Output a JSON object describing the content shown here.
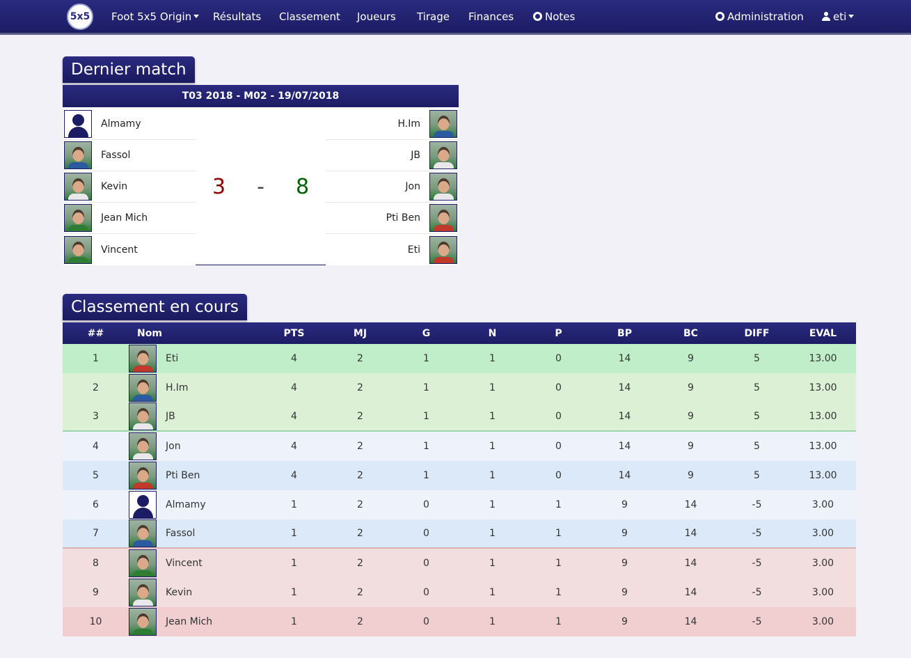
{
  "nav": {
    "logo_text": "5x5",
    "brand": "Foot 5x5 Origin",
    "items": [
      "Résultats",
      "Classement",
      "Joueurs",
      "Tirage",
      "Finances"
    ],
    "notes": "Notes",
    "admin": "Administration",
    "user": "eti"
  },
  "last_match": {
    "title": "Dernier match",
    "header": "T03 2018 - M02 - 19/07/2018",
    "team_left": [
      "Almamy",
      "Fassol",
      "Kevin",
      "Jean Mich",
      "Vincent"
    ],
    "team_right": [
      "H.Im",
      "JB",
      "Jon",
      "Pti Ben",
      "Eti"
    ],
    "score_left": "3",
    "score_sep": "-",
    "score_right": "8"
  },
  "ranking": {
    "title": "Classement en cours",
    "columns": [
      "##",
      "Nom",
      "PTS",
      "MJ",
      "G",
      "N",
      "P",
      "BP",
      "BC",
      "DIFF",
      "EVAL"
    ],
    "rows": [
      {
        "rank": "1",
        "name": "Eti",
        "pts": "4",
        "mj": "2",
        "g": "1",
        "n": "1",
        "p": "0",
        "bp": "14",
        "bc": "9",
        "diff": "5",
        "eval": "13.00"
      },
      {
        "rank": "2",
        "name": "H.Im",
        "pts": "4",
        "mj": "2",
        "g": "1",
        "n": "1",
        "p": "0",
        "bp": "14",
        "bc": "9",
        "diff": "5",
        "eval": "13.00"
      },
      {
        "rank": "3",
        "name": "JB",
        "pts": "4",
        "mj": "2",
        "g": "1",
        "n": "1",
        "p": "0",
        "bp": "14",
        "bc": "9",
        "diff": "5",
        "eval": "13.00"
      },
      {
        "rank": "4",
        "name": "Jon",
        "pts": "4",
        "mj": "2",
        "g": "1",
        "n": "1",
        "p": "0",
        "bp": "14",
        "bc": "9",
        "diff": "5",
        "eval": "13.00"
      },
      {
        "rank": "5",
        "name": "Pti Ben",
        "pts": "4",
        "mj": "2",
        "g": "1",
        "n": "1",
        "p": "0",
        "bp": "14",
        "bc": "9",
        "diff": "5",
        "eval": "13.00"
      },
      {
        "rank": "6",
        "name": "Almamy",
        "pts": "1",
        "mj": "2",
        "g": "0",
        "n": "1",
        "p": "1",
        "bp": "9",
        "bc": "14",
        "diff": "-5",
        "eval": "3.00"
      },
      {
        "rank": "7",
        "name": "Fassol",
        "pts": "1",
        "mj": "2",
        "g": "0",
        "n": "1",
        "p": "1",
        "bp": "9",
        "bc": "14",
        "diff": "-5",
        "eval": "3.00"
      },
      {
        "rank": "8",
        "name": "Vincent",
        "pts": "1",
        "mj": "2",
        "g": "0",
        "n": "1",
        "p": "1",
        "bp": "9",
        "bc": "14",
        "diff": "-5",
        "eval": "3.00"
      },
      {
        "rank": "9",
        "name": "Kevin",
        "pts": "1",
        "mj": "2",
        "g": "0",
        "n": "1",
        "p": "1",
        "bp": "9",
        "bc": "14",
        "diff": "-5",
        "eval": "3.00"
      },
      {
        "rank": "10",
        "name": "Jean Mich",
        "pts": "1",
        "mj": "2",
        "g": "0",
        "n": "1",
        "p": "1",
        "bp": "9",
        "bc": "14",
        "diff": "-5",
        "eval": "3.00"
      }
    ]
  },
  "colors": {
    "nav_bg": "#1c1c64",
    "score_left": "#8b0000",
    "score_right": "#006400",
    "row_green_strong": "#c0eec8",
    "row_green_light": "#dcf0d6",
    "row_blue_a": "#eef3fb",
    "row_blue_b": "#dce9f8",
    "row_red_light": "#f2dedf",
    "row_red_strong": "#f1cfd0"
  }
}
